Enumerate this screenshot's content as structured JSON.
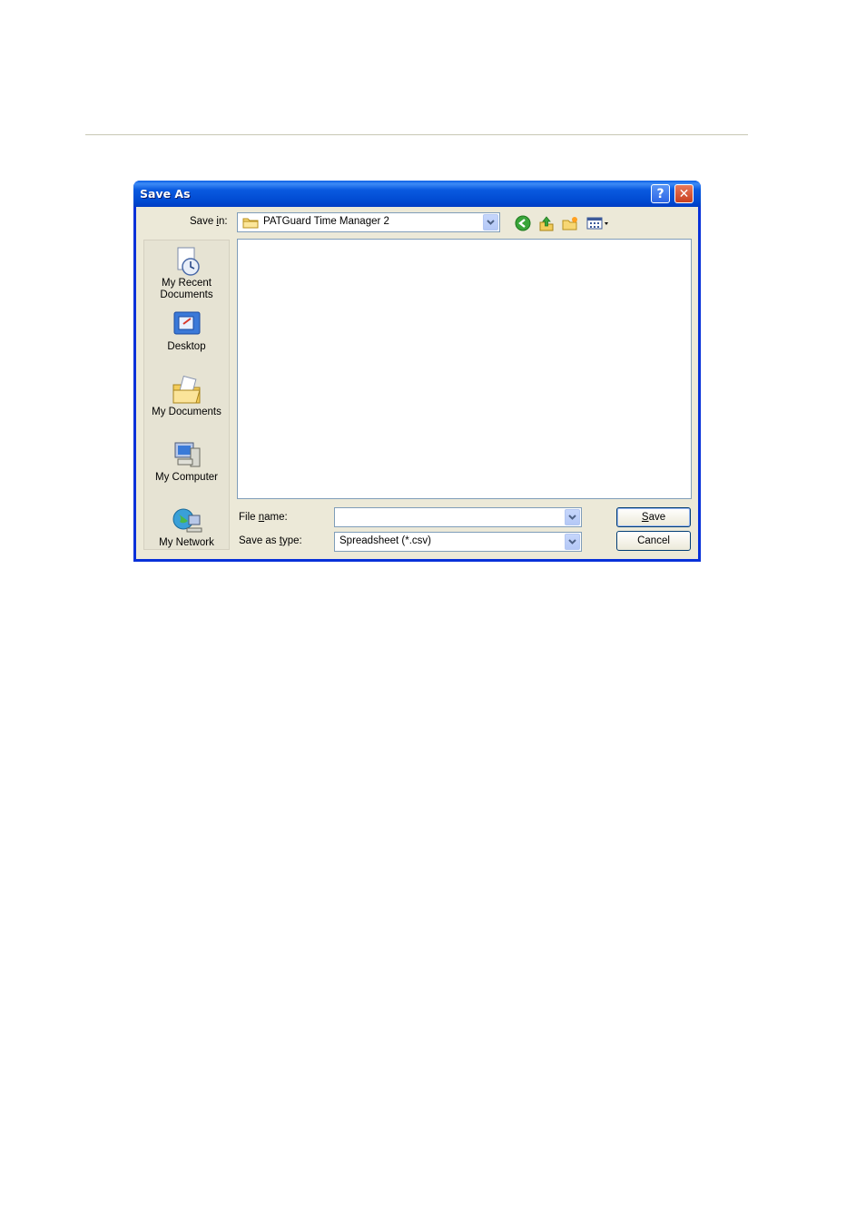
{
  "dialog": {
    "title": "Save As",
    "help_button": "?",
    "close_button": "✕"
  },
  "save_in": {
    "label_pre": "Save ",
    "label_ul": "i",
    "label_post": "n:",
    "value": "PATGuard Time Manager 2"
  },
  "places": [
    {
      "line1": "My Recent",
      "line2": "Documents",
      "icon": "recent-documents-icon"
    },
    {
      "line1": "Desktop",
      "line2": "",
      "icon": "desktop-icon"
    },
    {
      "line1": "My Documents",
      "line2": "",
      "icon": "my-documents-icon"
    },
    {
      "line1": "My Computer",
      "line2": "",
      "icon": "my-computer-icon"
    },
    {
      "line1": "My Network",
      "line2": "",
      "icon": "my-network-icon"
    }
  ],
  "file_name": {
    "label_pre": "File ",
    "label_ul": "n",
    "label_post": "ame:",
    "value": ""
  },
  "save_type": {
    "label_pre": "Save as ",
    "label_ul": "t",
    "label_post": "ype:",
    "value": "Spreadsheet (*.csv)"
  },
  "buttons": {
    "save_ul": "S",
    "save_rest": "ave",
    "cancel": "Cancel"
  },
  "colors": {
    "title_bar": "#0054e3",
    "client": "#ece9d8",
    "border": "#0831d9"
  }
}
